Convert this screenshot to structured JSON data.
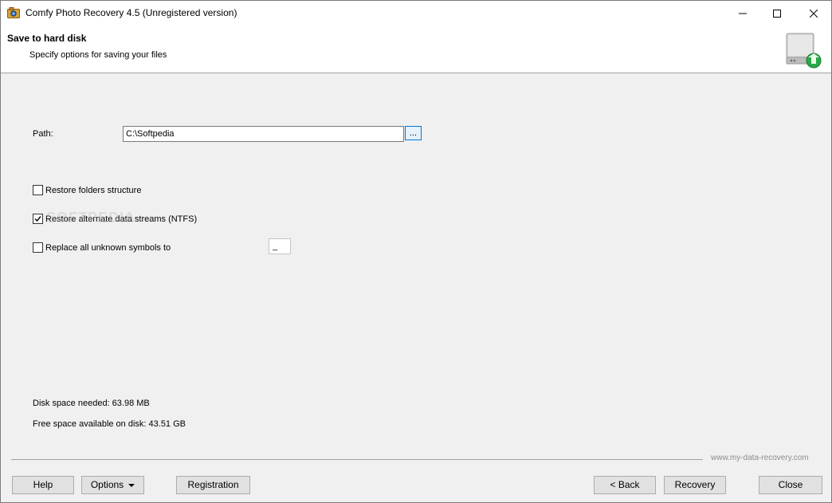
{
  "window": {
    "title": "Comfy Photo Recovery 4.5 (Unregistered version)"
  },
  "header": {
    "title": "Save to hard disk",
    "subtitle": "Specify options for saving your files"
  },
  "form": {
    "path_label": "Path:",
    "path_value": "C:\\Softpedia",
    "browse_label": "...",
    "options": [
      {
        "label": "Restore folders structure",
        "checked": false
      },
      {
        "label": "Restore alternate data streams (NTFS)",
        "checked": true
      },
      {
        "label": "Replace all unknown symbols to",
        "checked": false
      }
    ],
    "replace_symbol_value": "_"
  },
  "info": {
    "disk_space_needed": "Disk space needed: 63.98 MB",
    "free_space": "Free space available on disk: 43.51 GB"
  },
  "footer": {
    "site": "www.my-data-recovery.com",
    "help_label": "Help",
    "options_label": "Options",
    "registration_label": "Registration",
    "back_label": "< Back",
    "recovery_label": "Recovery",
    "close_label": "Close"
  },
  "watermark": "SOFTPEDIA",
  "colors": {
    "accent": "#0078d7",
    "icon_green": "#2aa84a"
  }
}
